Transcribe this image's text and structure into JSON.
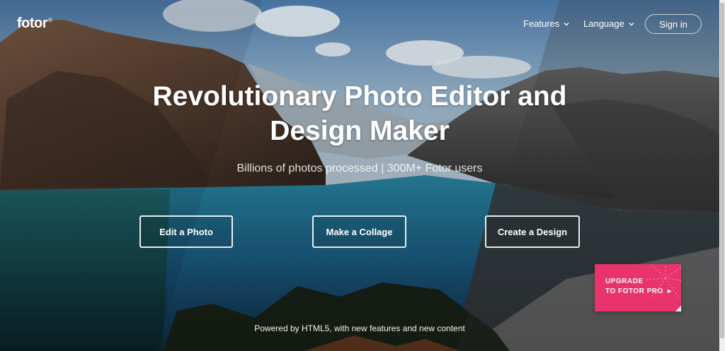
{
  "brand": {
    "logo": "fotor",
    "mark": "®"
  },
  "nav": {
    "features": "Features",
    "language": "Language",
    "signin": "Sign in"
  },
  "hero": {
    "title_line1": "Revolutionary Photo Editor and",
    "title_line2": "Design Maker",
    "subtitle": "Billions of photos processed | 300M+ Fotor users"
  },
  "actions": {
    "edit": "Edit a Photo",
    "collage": "Make a Collage",
    "design": "Create a Design"
  },
  "upgrade": {
    "line1": "UPGRADE",
    "line2": "TO FOTOR PRO",
    "arrow": "▸"
  },
  "footer": {
    "powered": "Powered by HTML5, with new features and new content"
  },
  "colors": {
    "upgrade": "#e8336d",
    "sky": "#5d86b0",
    "water": "#1d6b8e"
  },
  "icons": {
    "nav_dropdown": "chevron-down-icon",
    "upgrade_arrow": "play-arrow-icon"
  }
}
